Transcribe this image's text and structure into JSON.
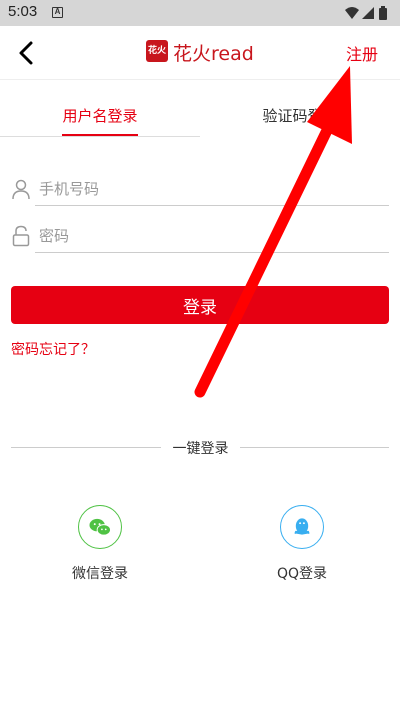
{
  "status_bar": {
    "time": "5:03",
    "notif_letter": "A"
  },
  "header": {
    "brand_seal": "花火",
    "brand_name": "花火read",
    "register_label": "注册"
  },
  "tabs": [
    {
      "label": "用户名登录"
    },
    {
      "label": "验证码登录"
    }
  ],
  "form": {
    "phone_placeholder": "手机号码",
    "password_placeholder": "密码",
    "login_label": "登录",
    "forgot_label": "密码忘记了？"
  },
  "quick_login": {
    "title": "一键登录",
    "wechat_label": "微信登录",
    "qq_label": "QQ登录"
  },
  "colors": {
    "accent": "#e60012",
    "wechat": "#4fc244",
    "qq": "#38aef0",
    "annotation_arrow": "#ff0000"
  },
  "icons": [
    "back-arrow-icon",
    "user-icon",
    "lock-icon",
    "wechat-icon",
    "qq-icon",
    "wifi-icon",
    "signal-icon",
    "battery-icon"
  ]
}
